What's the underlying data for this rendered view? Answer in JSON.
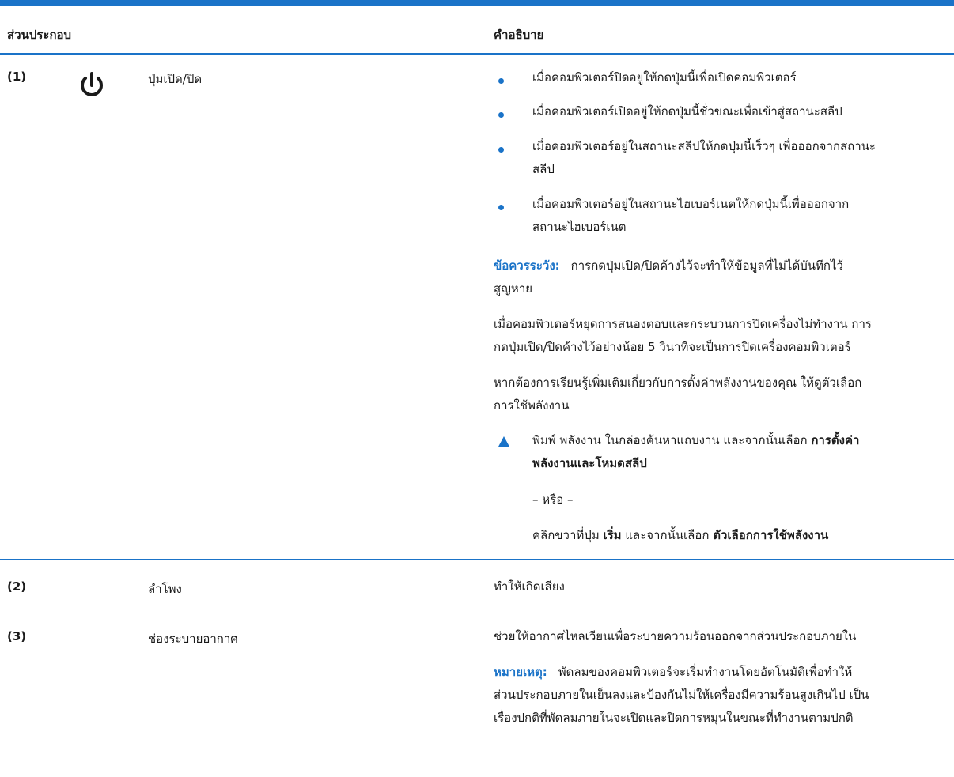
{
  "header": {
    "col_component": "ส่วนประกอบ",
    "col_description": "คำอธิบาย"
  },
  "rows": [
    {
      "num": "(1)",
      "name": "ปุ่มเปิด/ปิด",
      "icon": "power-icon",
      "bullets": [
        [
          "เมื่อคอมพิวเตอร์ปิดอยู่ให้กดปุ่มนี้เพื่อเปิดคอมพิวเตอร์"
        ],
        [
          "เมื่อคอมพิวเตอร์เปิดอยู่ให้กดปุ่มนี้ชั่วขณะเพื่อเข้าสู่สถานะสลีป"
        ],
        [
          "เมื่อคอมพิวเตอร์อยู่ในสถานะสลีปให้กดปุ่มนี้เร็วๆ เพื่อออกจากสถานะ",
          "สลีป"
        ],
        [
          "เมื่อคอมพิวเตอร์อยู่ในสถานะไฮเบอร์เนตให้กดปุ่มนี้เพื่อออกจาก",
          "สถานะไฮเบอร์เนต"
        ]
      ],
      "caution_label": "ข้อควรระวัง:",
      "caution_text": [
        "การกดปุ่มเปิด/ปิดค้างไว้จะทำให้ข้อมูลที่ไม่ได้บันทึกไว้",
        "สูญหาย"
      ],
      "para1": [
        "เมื่อคอมพิวเตอร์หยุดการสนองตอบและกระบวนการปิดเครื่องไม่ทำงาน การ",
        "กดปุ่มเปิด/ปิดค้างไว้อย่างน้อย 5 วินาทีจะเป็นการปิดเครื่องคอมพิวเตอร์"
      ],
      "para2": [
        "หากต้องการเรียนรู้เพิ่มเติมเกี่ยวกับการตั้งค่าพลังงานของคุณ ให้ดูตัวเลือก",
        "การใช้พลังงาน"
      ],
      "step_text1": "พิมพ์ พลังงาน ในกล่องค้นหาแถบงาน และจากนั้นเลือก ",
      "step_bold1": "การตั้งค่า",
      "step_bold2": "พลังงานและโหมดสลีป",
      "or_text": "– หรือ –",
      "alt_text1": "คลิกขวาที่ปุ่ม ",
      "alt_bold1": "เริ่ม",
      "alt_text2": " และจากนั้นเลือก ",
      "alt_bold2": "ตัวเลือกการใช้พลังงาน"
    },
    {
      "num": "(2)",
      "name": "ลำโพง",
      "description": "ทำให้เกิดเสียง"
    },
    {
      "num": "(3)",
      "name": "ช่องระบายอากาศ",
      "description": "ช่วยให้อากาศไหลเวียนเพื่อระบายความร้อนออกจากส่วนประกอบภายใน",
      "note_label": "หมายเหตุ:",
      "note_text": [
        "พัดลมของคอมพิวเตอร์จะเริ่มทำงานโดยอัตโนมัติเพื่อทำให้",
        "ส่วนประกอบภายในเย็นลงและป้องกันไม่ให้เครื่องมีความร้อนสูงเกินไป เป็น",
        "เรื่องปกติที่พัดลมภายในจะเปิดและปิดการหมุนในขณะที่ทำงานตามปกติ"
      ]
    }
  ],
  "colors": {
    "accent": "#1a73c8",
    "text": "#1a1a1a"
  }
}
